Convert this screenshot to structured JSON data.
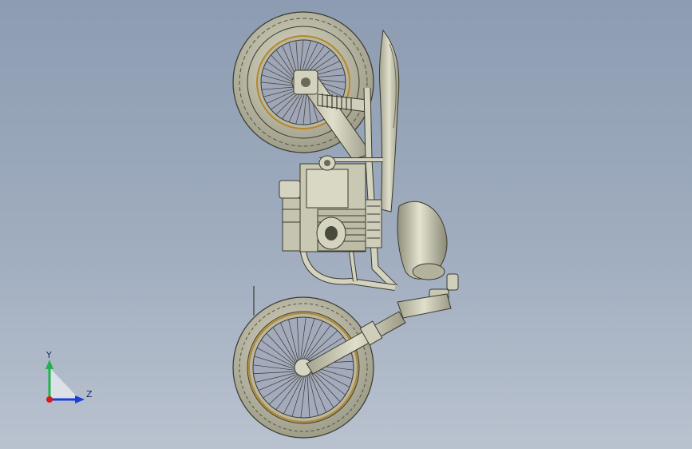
{
  "viewport": {
    "background_top": "#8d9cb2",
    "background_bottom": "#b9c2cf",
    "model": {
      "name": "motorcycle-assembly",
      "part_color": "#c7c6b0",
      "edge_color": "#3a3a30",
      "rim_accent": "#b8862a"
    }
  },
  "triad": {
    "y_label": "Y",
    "z_label": "Z",
    "y_color": "#22b14c",
    "z_color": "#1c3fd6",
    "origin_color": "#d81c1c"
  }
}
